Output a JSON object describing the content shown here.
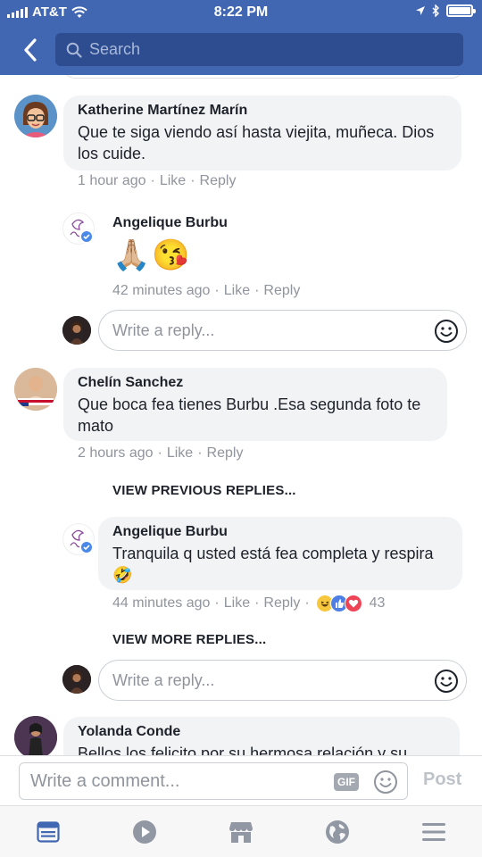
{
  "status_bar": {
    "carrier": "AT&T",
    "time": "8:22 PM",
    "icons": [
      "signal-icon",
      "wifi-icon",
      "location-icon",
      "bluetooth-icon",
      "battery-icon"
    ],
    "battery_level": 1.0
  },
  "header": {
    "back_icon": "chevron-left-icon",
    "search_placeholder": "Search",
    "bg_color": "#4267b2",
    "search_bg_color": "#2d4d90"
  },
  "comments": [
    {
      "author": "Katherine Martínez Marín",
      "text": "Que te siga viendo así hasta viejita, muñeca. Dios los cuide.",
      "time": "1 hour ago",
      "like": "Like",
      "reply": "Reply",
      "replies": [
        {
          "author": "Angelique Burbu",
          "verified": true,
          "text": "🙏🏼😘",
          "time": "42 minutes ago",
          "like": "Like",
          "reply": "Reply"
        }
      ],
      "reply_placeholder": "Write a reply..."
    },
    {
      "author": "Chelín Sanchez",
      "text": "Que boca fea tienes Burbu .Esa segunda foto te mato",
      "time": "2 hours ago",
      "like": "Like",
      "reply": "Reply",
      "view_previous": "VIEW PREVIOUS REPLIES...",
      "replies": [
        {
          "author": "Angelique Burbu",
          "verified": true,
          "text": "Tranquila q usted está fea completa y respira",
          "emoji": "🤣",
          "time": "44 minutes ago",
          "like": "Like",
          "reply": "Reply",
          "reactions": [
            "haha-reaction-icon",
            "like-reaction-icon",
            "love-reaction-icon"
          ],
          "reaction_count": "43"
        }
      ],
      "view_more": "VIEW MORE REPLIES...",
      "reply_placeholder": "Write a reply..."
    },
    {
      "author": "Yolanda Conde",
      "text": "Bellos los felicito por su hermosa relación y su"
    }
  ],
  "composer": {
    "placeholder": "Write a comment...",
    "gif_label": "GIF",
    "post_label": "Post"
  },
  "tabbar": {
    "tabs": [
      "news-feed-icon",
      "watch-icon",
      "marketplace-icon",
      "notifications-globe-icon",
      "menu-icon"
    ],
    "active_color": "#4267b2",
    "inactive_color": "#9197a3"
  }
}
